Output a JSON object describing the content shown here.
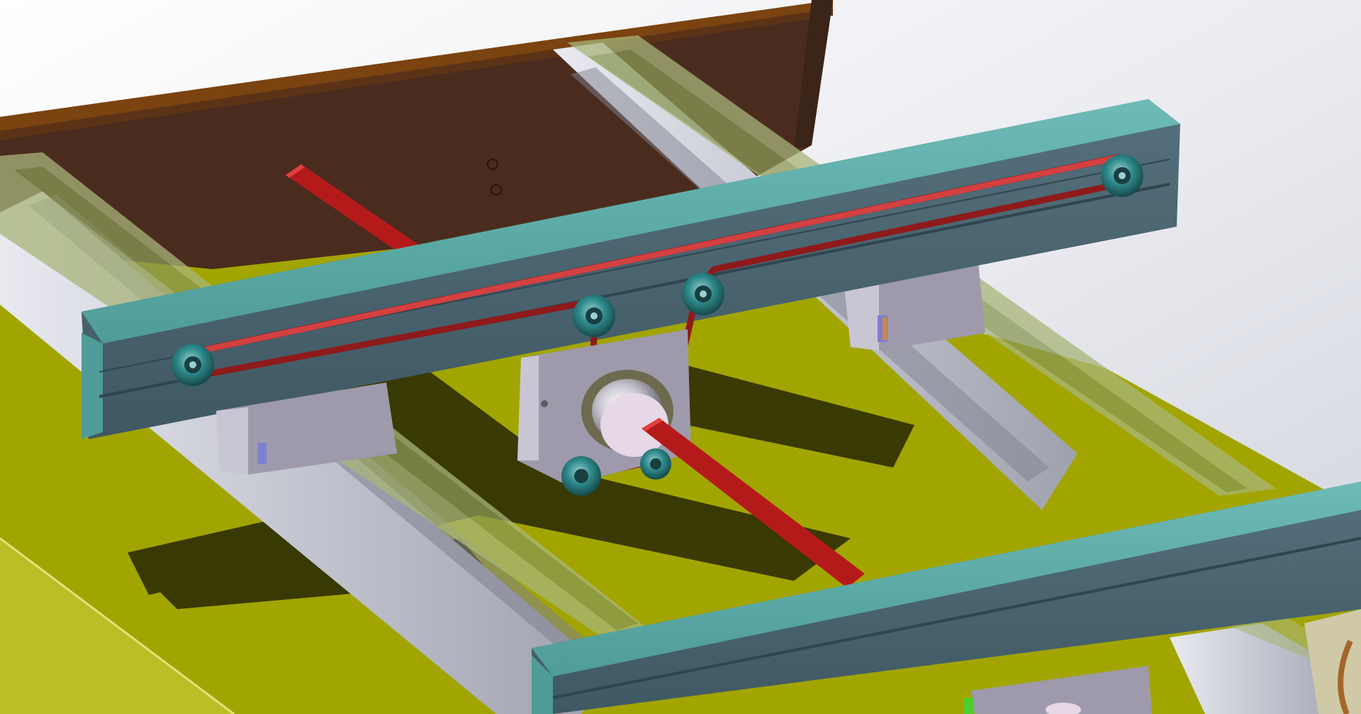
{
  "view": {
    "type": "cad-3d-shaded-viewport",
    "background_colors": [
      "#ffffff",
      "#cfd3dc"
    ]
  },
  "colors": {
    "base_plate": "#a2a500",
    "base_plate_shadow": "#1f1f05",
    "rail": "#c2c4cf",
    "rail_slot": "#7f8190",
    "linear_guide_cover": "#a9b57a",
    "back_panel_face": "#4a2c1e",
    "back_panel_top": "#7a4310",
    "crossbar_top": "#55a5a2",
    "crossbar_face": "#4b6470",
    "belt": "#8e1a1a",
    "drive_shaft": "#b51a1a",
    "pulley": "#2f8a8c",
    "carriage_block": "#9e9aab",
    "bearing_hub": "#e6d8e6",
    "indicator_clip": "#7f7fd0",
    "connector_pins": "#cc8844",
    "green_part": "#4fcf2f"
  },
  "components": [
    "back-panel",
    "base-plate",
    "left-rail",
    "middle-rail",
    "right-rail",
    "linear-guide-left",
    "linear-guide-middle",
    "linear-guide-right",
    "crossbar-upper",
    "crossbar-lower",
    "timing-belt",
    "drive-shaft",
    "idler-pulley-left",
    "idler-pulley-right",
    "tension-pulley-left",
    "tension-pulley-right",
    "drive-pulley-bottom-left",
    "drive-pulley-bottom-right",
    "motor-mount-plate",
    "bearing-flange",
    "carriage-block-left",
    "carriage-block-right",
    "carriage-block-back"
  ]
}
